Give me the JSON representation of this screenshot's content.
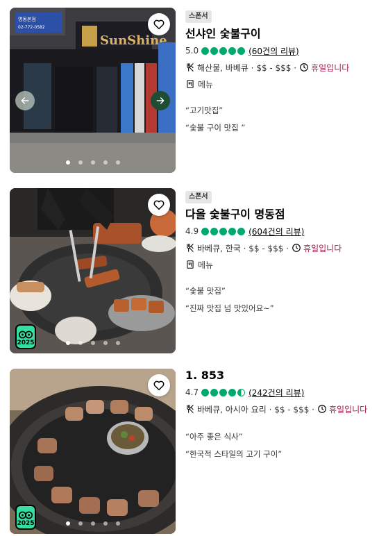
{
  "restaurants": [
    {
      "sponsored_label": "스폰서",
      "name": "선샤인 숯불구이",
      "rating": "5.0",
      "bubbles": 5,
      "reviews": "(60건의 리뷰)",
      "cuisine": "해산물, 바베큐 · $$ - $$$ ·",
      "status": "휴일입니다",
      "menu_label": "메뉴",
      "quotes": [
        "“고기맛집”",
        "“숯불 구이 맛집 ”"
      ],
      "sign_text": [
        "명동본점",
        "02-772-0582",
        "SunShine"
      ],
      "photo_index": 1,
      "photo_count": 5,
      "has_2025_badge": false,
      "badge_year": ""
    },
    {
      "sponsored_label": "스폰서",
      "name": "다올 숯불구이 명동점",
      "rating": "4.9",
      "bubbles": 5,
      "reviews": "(604건의 리뷰)",
      "cuisine": "바베큐, 한국 · $$ - $$$ ·",
      "status": "휴일입니다",
      "menu_label": "메뉴",
      "quotes": [
        "“숯불 맛집”",
        "“진짜 맛집 넘 맛있어요~”"
      ],
      "photo_index": 1,
      "photo_count": 5,
      "has_2025_badge": true,
      "badge_year": "2025"
    },
    {
      "sponsored_label": "",
      "name": "1. 853",
      "rating": "4.7",
      "bubbles": 4.5,
      "reviews": "(242건의 리뷰)",
      "cuisine": "바베큐, 아시아 요리 · $$ - $$$ ·",
      "status": "휴일입니다",
      "menu_label": "",
      "quotes": [
        "“아주 좋은 식사”",
        "“한국적 스타일의 고기 구이”"
      ],
      "photo_index": 1,
      "photo_count": 5,
      "has_2025_badge": true,
      "badge_year": "2025"
    }
  ],
  "colors": {
    "bubble_green": "#00aa6c",
    "closed_red": "#a61c4a",
    "nav_next_green": "#1f4d33",
    "badge_green": "#34e0a1"
  },
  "icons": {
    "heart": "heart-icon",
    "utensils": "fork-knife-icon",
    "clock": "clock-icon",
    "menu": "menu-book-icon",
    "prev": "arrow-left-icon",
    "next": "arrow-right-icon"
  }
}
